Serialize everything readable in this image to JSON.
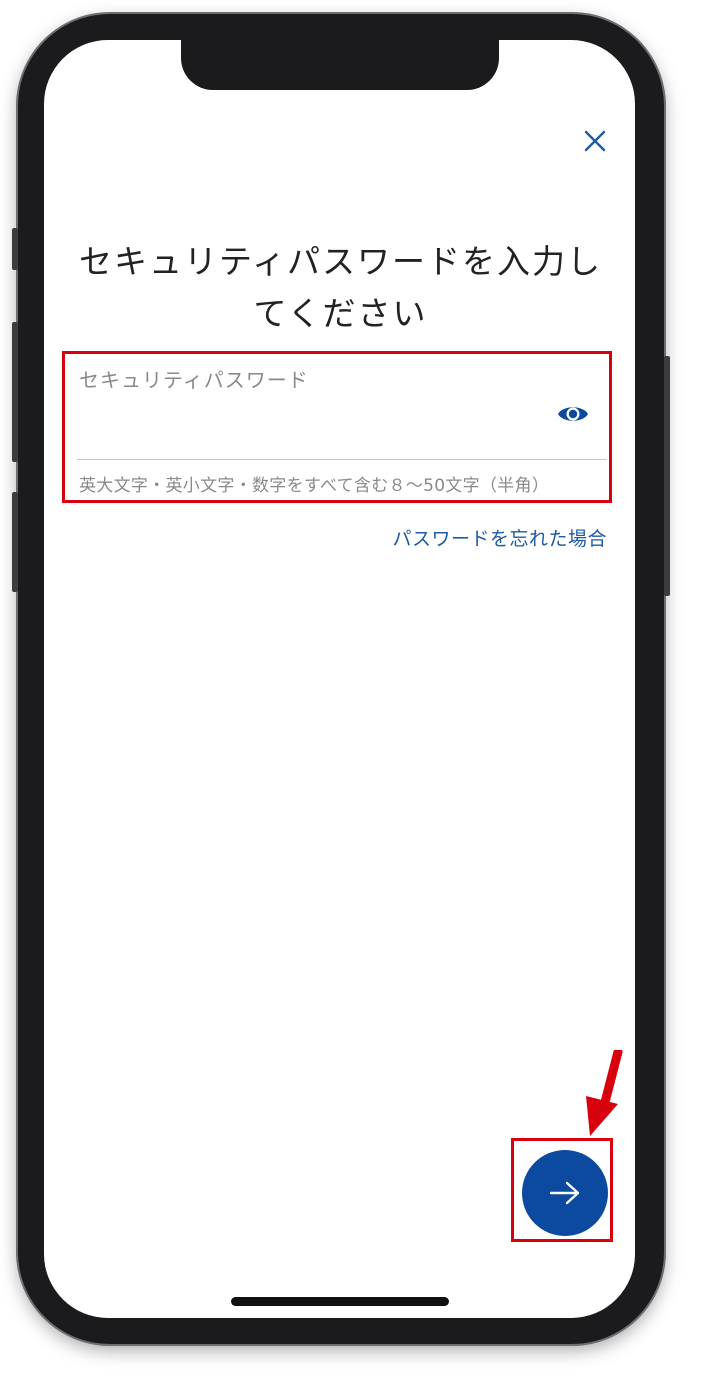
{
  "screen": {
    "title": "セキュリティパスワードを入力してください"
  },
  "password_field": {
    "label": "セキュリティパスワード",
    "value": "",
    "hint": "英大文字・英小文字・数字をすべて含む８〜50文字（半角）"
  },
  "links": {
    "forgot_password": "パスワードを忘れた場合"
  },
  "icons": {
    "close": "close-icon",
    "show_password": "eye-icon",
    "next": "arrow-right-icon",
    "annotation": "red-arrow-icon"
  },
  "colors": {
    "accent": "#0b4a9e",
    "link": "#1d5ba4",
    "highlight": "#d9000d",
    "text": "#222222",
    "muted": "#8a8a8a"
  }
}
